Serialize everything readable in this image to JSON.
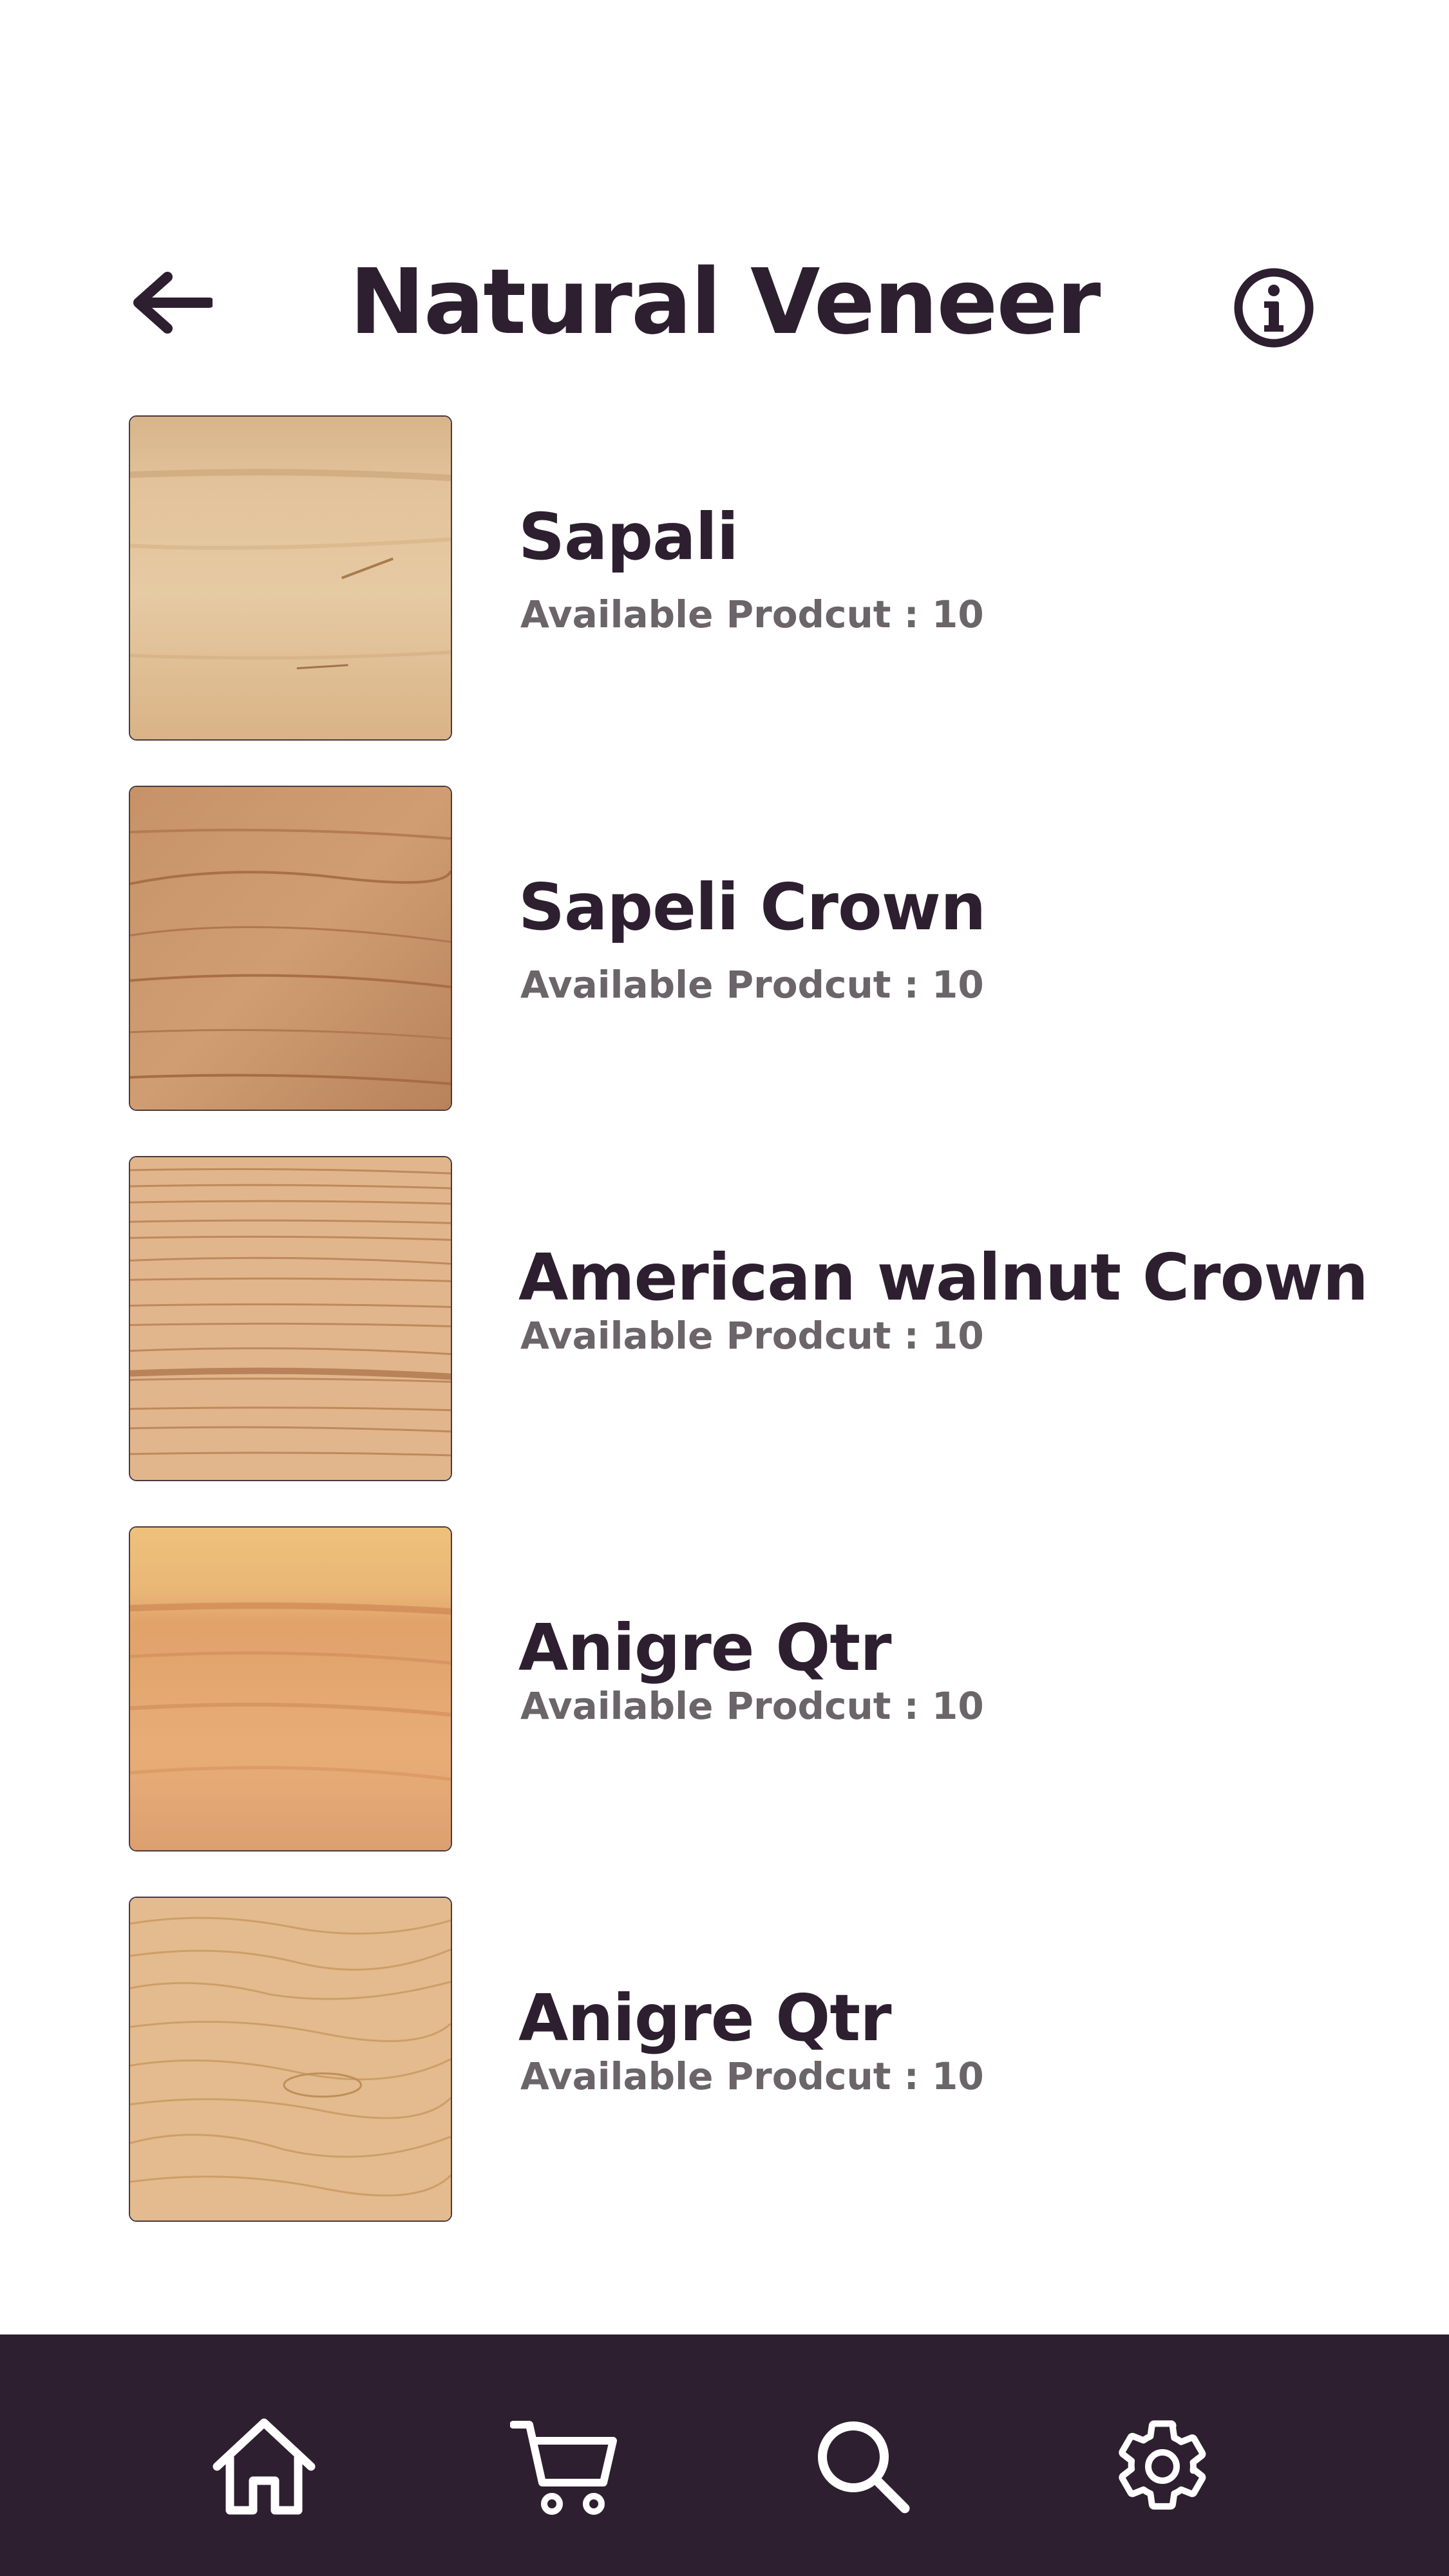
{
  "header": {
    "title": "Natural Veneer",
    "back_icon": "arrow-left-icon",
    "info_icon": "info-icon"
  },
  "items": [
    {
      "name": "Sapali",
      "count_text": "Available Prodcut : 10",
      "texture": "light-maple"
    },
    {
      "name": "Sapeli Crown",
      "count_text": "Available Prodcut : 10",
      "texture": "cherry"
    },
    {
      "name": "American walnut Crown",
      "count_text": "Available Prodcut : 10",
      "texture": "oak-stripe"
    },
    {
      "name": "Anigre Qtr",
      "count_text": "Available Prodcut : 10",
      "texture": "golden-anigre"
    },
    {
      "name": "Anigre Qtr",
      "count_text": "Available Prodcut : 10",
      "texture": "light-oak"
    }
  ],
  "bottom_nav": {
    "items": [
      "home-icon",
      "cart-icon",
      "search-icon",
      "settings-icon"
    ],
    "background": "#2d1f2f"
  },
  "colors": {
    "primary_text": "#2d1f2f",
    "secondary_text": "#6b6468",
    "nav_icon": "#ffffff"
  }
}
